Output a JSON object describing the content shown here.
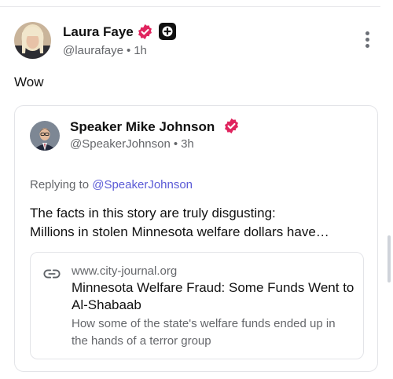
{
  "post": {
    "author": {
      "name": "Laura Faye",
      "handle": "@laurafaye",
      "time": "1h",
      "verified_color": "#e0245e"
    },
    "text": "Wow"
  },
  "quote": {
    "author": {
      "name": "Speaker Mike Johnson",
      "handle": "@SpeakerJohnson",
      "time": "3h"
    },
    "replying_prefix": "Replying to",
    "replying_handle": "@SpeakerJohnson",
    "text_line1": "The facts in this story are truly disgusting:",
    "text_line2": "Millions in stolen Minnesota welfare dollars have…",
    "link": {
      "domain": "www.city-journal.org",
      "title": "Minnesota Welfare Fraud: Some Funds Went to Al-Shabaab",
      "description": "How some of the state's welfare funds ended up in the hands of a terror group"
    }
  },
  "meta": {
    "separator": "•",
    "accent_link_color": "#5b5bd6",
    "icons": [
      "verified-badge-icon",
      "plus-icon",
      "more-vertical-icon",
      "link-icon"
    ]
  }
}
